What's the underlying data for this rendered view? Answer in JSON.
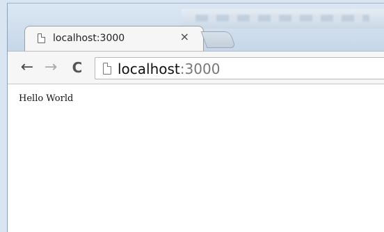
{
  "browser": {
    "tab": {
      "title": "localhost:3000",
      "close_icon": "close-icon",
      "favicon": "page-icon"
    },
    "toolbar": {
      "back_icon": "←",
      "forward_icon": "→",
      "reload_icon": "C",
      "url_host": "localhost",
      "url_port": ":3000"
    }
  },
  "page": {
    "body_text": "Hello World"
  }
}
